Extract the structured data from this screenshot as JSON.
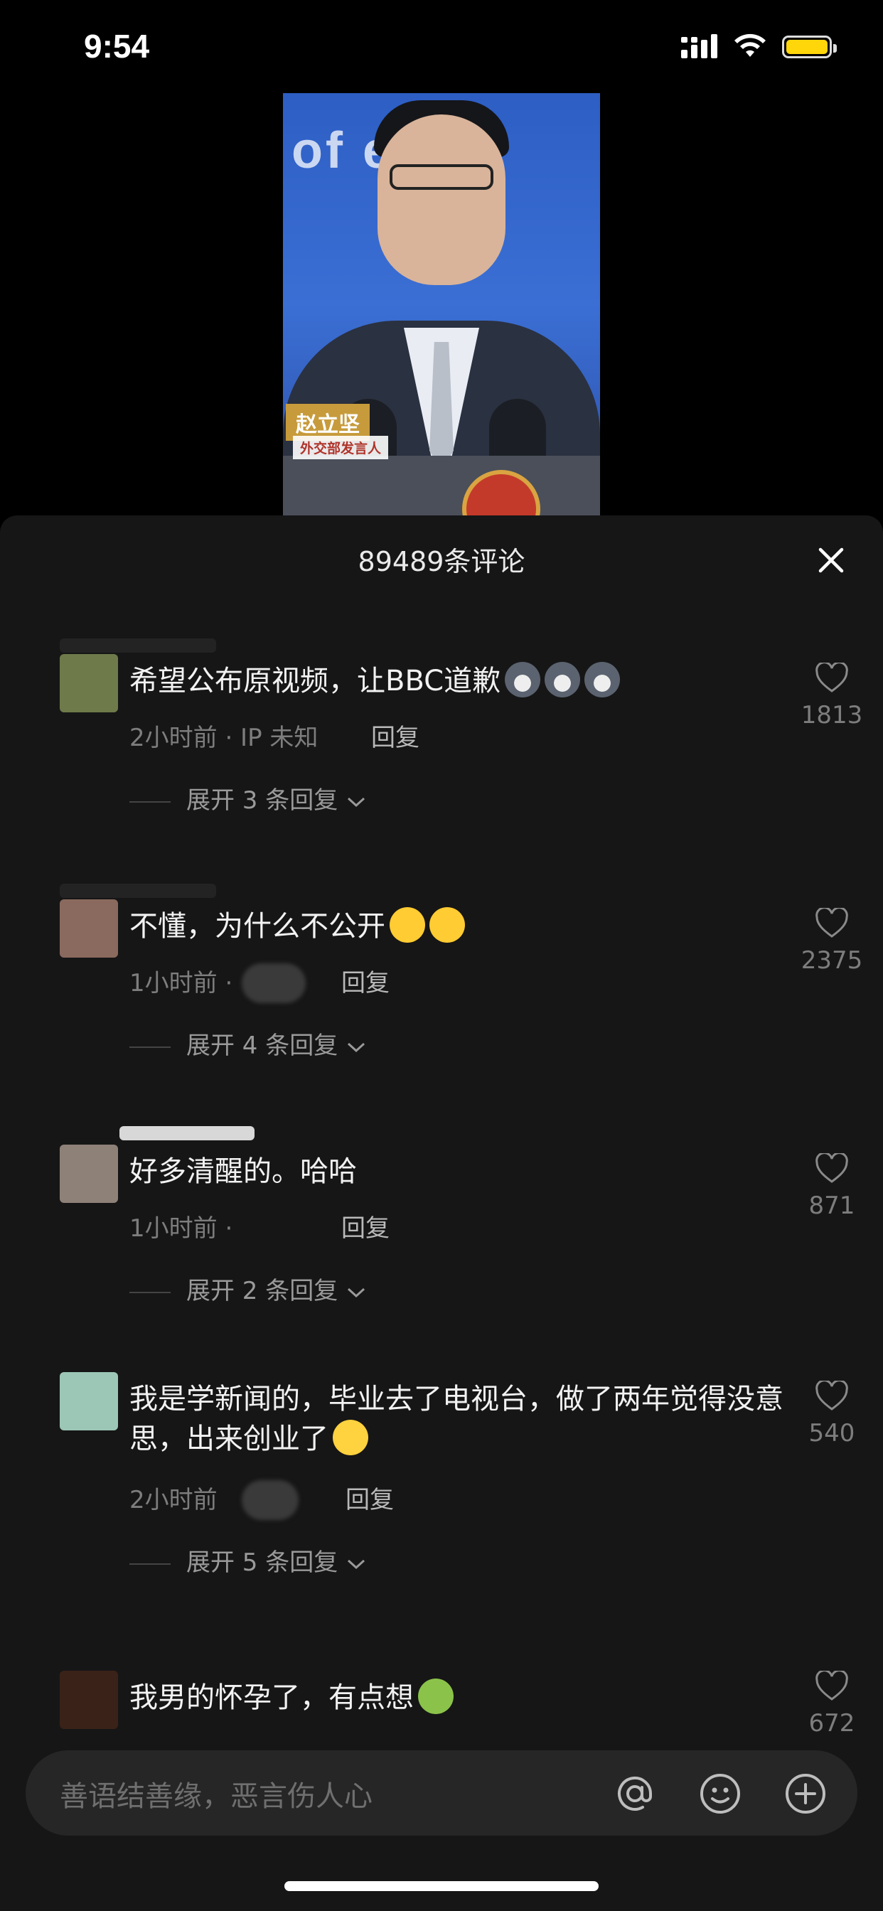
{
  "status_bar": {
    "time": "9:54"
  },
  "video": {
    "wall_text": "of  eign",
    "name_tag": "赵立坚",
    "title_tag": "外交部发言人"
  },
  "comments_sheet": {
    "title": "89489条评论",
    "input_placeholder": "善语结善缘，恶言伤人心",
    "comments": [
      {
        "text": "希望公布原视频，让BBC道歉",
        "time": "2小时前 · IP 未知",
        "reply": "回复",
        "expand": "展开 3 条回复",
        "likes": "1813",
        "avatar_color": "#6e7a4a"
      },
      {
        "text": "不懂，为什么不公开",
        "time": "1小时前 ·",
        "reply": "回复",
        "expand": "展开 4 条回复",
        "likes": "2375",
        "avatar_color": "#8a6a5e"
      },
      {
        "text": "好多清醒的。哈哈",
        "time": "1小时前 ·",
        "reply": "回复",
        "expand": "展开 2 条回复",
        "likes": "871",
        "avatar_color": "#8e8178"
      },
      {
        "text": "我是学新闻的，毕业去了电视台，做了两年觉得没意思，出来创业了",
        "time": "2小时前",
        "reply": "回复",
        "expand": "展开 5 条回复",
        "likes": "540",
        "avatar_color": "#9cc7b6"
      },
      {
        "text": "我男的怀孕了，有点想",
        "likes": "672",
        "avatar_color": "#3a2218"
      }
    ]
  },
  "icons": {
    "close": "close-icon",
    "heart": "heart-icon",
    "at": "at-icon",
    "emoji": "emoji-icon",
    "plus": "plus-icon"
  }
}
